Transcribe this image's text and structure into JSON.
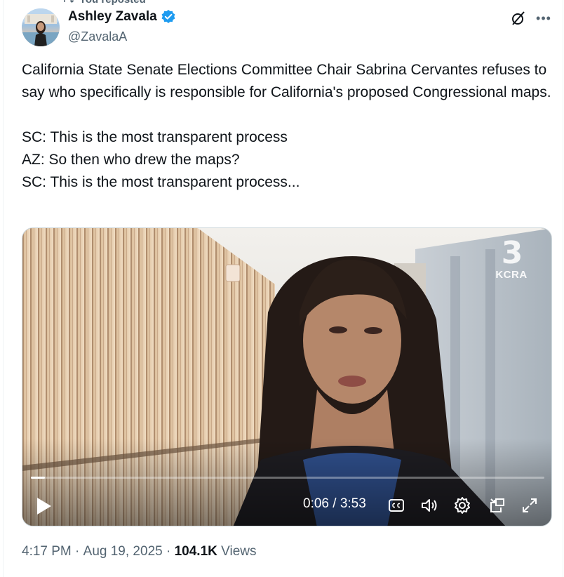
{
  "repost_label": "You reposted",
  "author": {
    "display_name": "Ashley Zavala",
    "handle": "@ZavalaA"
  },
  "tweet": {
    "text": "California State Senate Elections Committee Chair Sabrina Cervantes refuses to say who specifically is responsible for California's proposed Congressional maps.\n\nSC: This is the most transparent process\nAZ: So then who drew the maps?\nSC: This is the most transparent process..."
  },
  "video": {
    "station_number": "3",
    "station_name": "KCRA",
    "current_time": "0:06",
    "duration": "3:53",
    "time_display": "0:06 / 3:53",
    "progress_fraction": 0.027
  },
  "meta": {
    "time": "4:17 PM",
    "date": "Aug 19, 2025",
    "separator": " · ",
    "views_count": "104.1K",
    "views_label": " Views"
  },
  "colors": {
    "verified": "#1d9bf0",
    "secondary_text": "#536471",
    "primary_text": "#0f1419"
  },
  "icons": {
    "grok": "grok-icon",
    "more": "more-icon",
    "play": "play-icon",
    "captions": "captions-icon",
    "volume": "volume-icon",
    "settings": "gear-icon",
    "pip": "picture-in-picture-icon",
    "fullscreen": "fullscreen-icon"
  }
}
